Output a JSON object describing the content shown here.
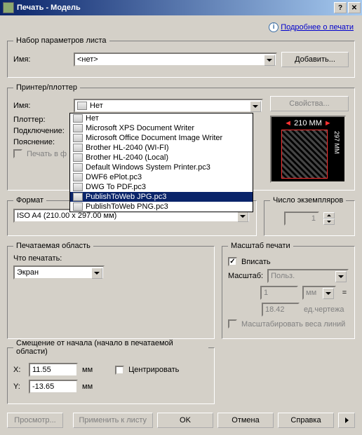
{
  "window": {
    "title": "Печать - Модель"
  },
  "link_row": {
    "text": "Подробнее о печати"
  },
  "page_setup": {
    "legend": "Набор параметров листа",
    "name_label": "Имя:",
    "name_value": "<нет>",
    "add_btn": "Добавить..."
  },
  "printer": {
    "legend": "Принтер/плоттер",
    "name_label": "Имя:",
    "name_value": "Нет",
    "properties_btn": "Свойства...",
    "plotter_label": "Плоттер:",
    "conn_label": "Подключение:",
    "desc_label": "Пояснение:",
    "print_to_file": "Печать в ф",
    "dropdown_items": [
      "Нет",
      "Microsoft XPS Document Writer",
      "Microsoft Office Document Image Writer",
      "Brother HL-2040 (WI-FI)",
      "Brother HL-2040 (Local)",
      "Default Windows System Printer.pc3",
      "DWF6 ePlot.pc3",
      "DWG To PDF.pc3",
      "PublishToWeb JPG.pc3",
      "PublishToWeb PNG.pc3"
    ],
    "selected_index": 8,
    "preview_top": "210 MM",
    "preview_side": "297 MM"
  },
  "format": {
    "legend": "Формат",
    "value": "ISO A4 (210.00 x 297.00 мм)"
  },
  "copies": {
    "legend": "Число экземпляров",
    "value": "1"
  },
  "print_area": {
    "legend": "Печатаемая область",
    "what_label": "Что печатать:",
    "what_value": "Экран"
  },
  "scale": {
    "legend": "Масштаб печати",
    "fit_label": "Вписать",
    "scale_label": "Масштаб:",
    "scale_value": "Польз.",
    "up_value": "1",
    "up_unit": "мм",
    "down_value": "18.42",
    "down_unit": "ед.чертежа",
    "scale_lw": "Масштабировать веса линий"
  },
  "offset": {
    "legend": "Смещение от начала (начало в печатаемой области)",
    "x_label": "X:",
    "x_value": "11.55",
    "y_label": "Y:",
    "y_value": "-13.65",
    "unit": "мм",
    "center": "Центрировать"
  },
  "footer": {
    "preview": "Просмотр...",
    "apply": "Применить к листу",
    "ok": "OK",
    "cancel": "Отмена",
    "help": "Справка"
  }
}
